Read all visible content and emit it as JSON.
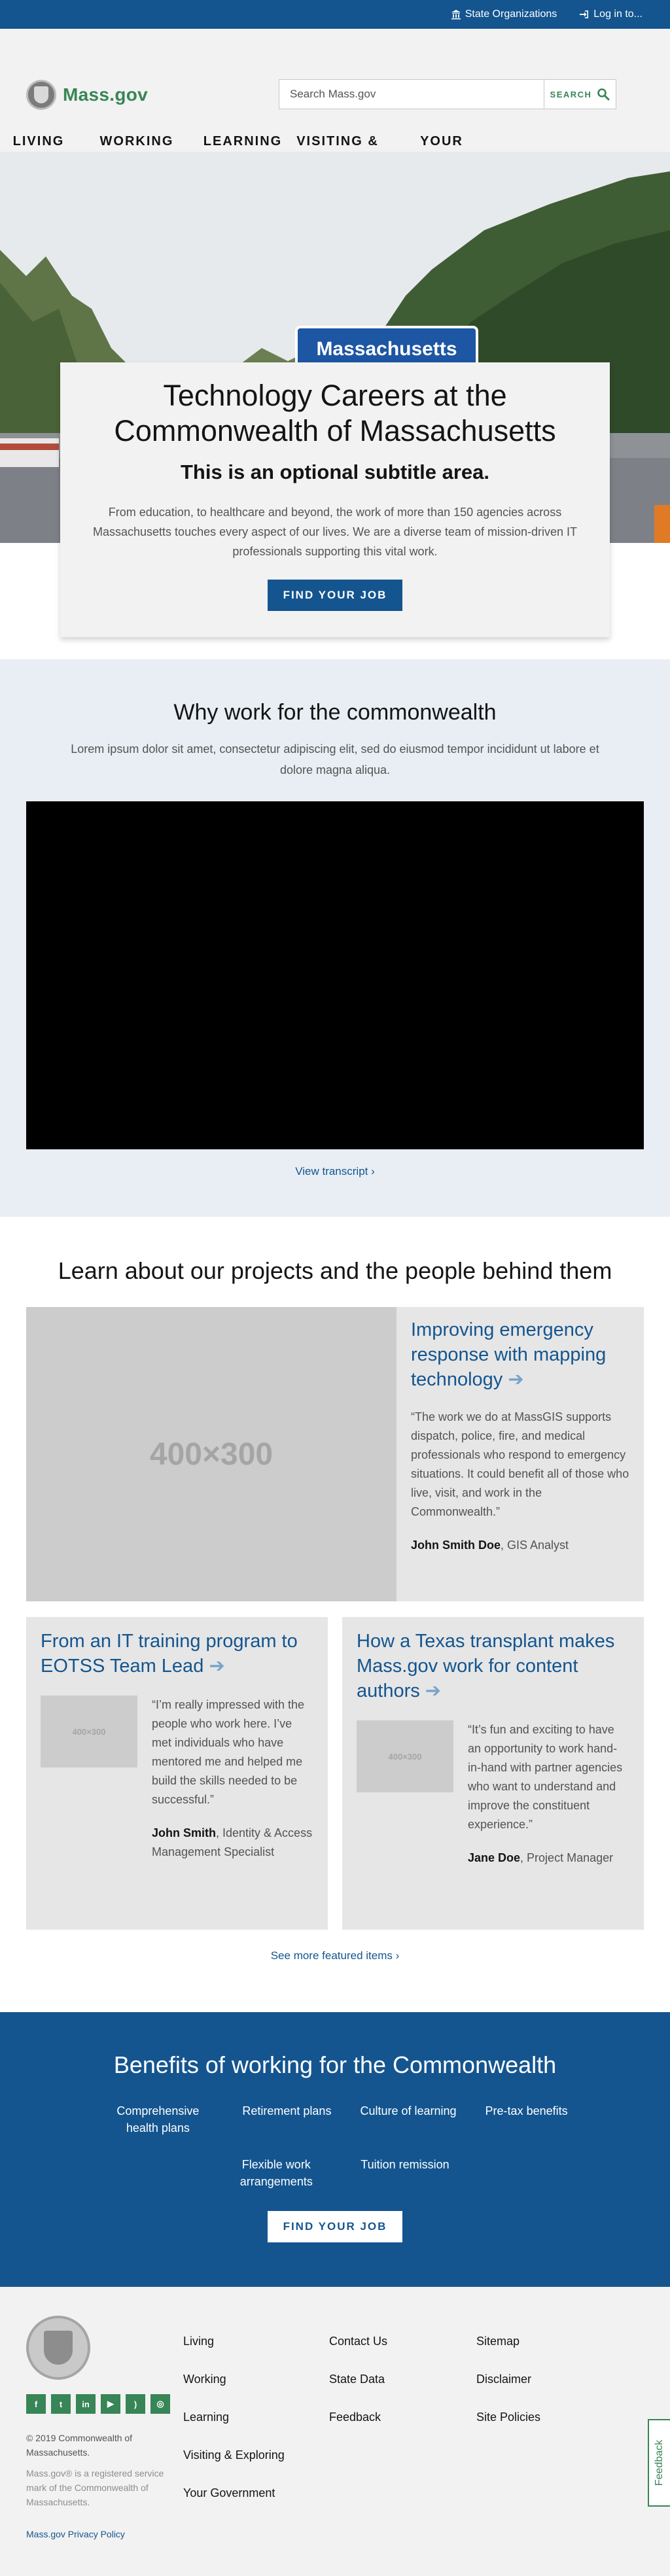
{
  "utility": {
    "state_orgs": "State Organizations",
    "login": "Log in to..."
  },
  "header": {
    "logo": "Mass.gov",
    "search_placeholder": "Search Mass.gov",
    "search_button": "SEARCH",
    "nav": [
      {
        "label": "LIVING"
      },
      {
        "label": "WORKING"
      },
      {
        "label": "LEARNING"
      },
      {
        "label": "VISITING & EXPLORING"
      },
      {
        "label": "YOUR GOVERNMENT"
      }
    ]
  },
  "hero": {
    "sign_text": "Massachusetts",
    "title": "Technology Careers at the Commonwealth of Massachusetts",
    "subtitle": "This is an optional subtitle area.",
    "description": "From education, to healthcare and beyond, the work of more than 150 agencies across Massachusetts touches every aspect of our lives. We are a diverse team of mission-driven IT professionals supporting this vital work.",
    "button": "FIND YOUR JOB"
  },
  "why": {
    "title": "Why work for the commonwealth",
    "text": "Lorem ipsum dolor sit amet, consectetur adipiscing elit, sed do eiusmod tempor incididunt ut labore et dolore magna aliqua.",
    "transcript_link": "View transcript"
  },
  "projects": {
    "title": "Learn about our projects and the people behind them",
    "feature": {
      "image": "400×300",
      "title": "Improving emergency response with mapping technology",
      "quote": "“The work we do at MassGIS supports dispatch, police, fire, and medical professionals who respond to emergency situations. It could benefit all of those who live, visit, and work in the Commonwealth.”",
      "name": "John Smith Doe",
      "role": ", GIS Analyst"
    },
    "cards": [
      {
        "image": "400×300",
        "title": "From an IT training program to EOTSS Team Lead",
        "quote": "“I’m really impressed with the people who work here. I’ve met individuals who have mentored me and helped me build the skills needed to be successful.”",
        "name": "John Smith",
        "role": ", Identity & Access Management Specialist"
      },
      {
        "image": "400×300",
        "title": "How a Texas transplant makes Mass.gov work for content authors",
        "quote": "“It’s fun and exciting to have an opportunity to work hand-in-hand with partner agencies who want to understand and improve the constituent experience.”",
        "name": "Jane Doe",
        "role": ", Project Manager"
      }
    ],
    "see_more": "See more featured items"
  },
  "benefits": {
    "title": "Benefits of working for the Commonwealth",
    "items_row1": [
      {
        "label": "Comprehensive health plans"
      },
      {
        "label": "Retirement plans"
      },
      {
        "label": "Culture of learning"
      },
      {
        "label": "Pre-tax benefits"
      }
    ],
    "items_row2": [
      {
        "label": "Flexible work arrangements"
      },
      {
        "label": "Tuition remission"
      }
    ],
    "button": "FIND YOUR JOB"
  },
  "footer": {
    "copyright": "© 2019 Commonwealth of Massachusetts.",
    "trademark": "Mass.gov® is a registered service mark of the Commonwealth of Massachusetts.",
    "privacy": "Mass.gov Privacy Policy",
    "col1": [
      "Living",
      "Working",
      "Learning",
      "Visiting & Exploring",
      "Your Government"
    ],
    "col2": [
      "Contact Us",
      "State Data",
      "Feedback"
    ],
    "col3": [
      "Sitemap",
      "Disclaimer",
      "Site Policies"
    ],
    "feedback_tab": "Feedback"
  }
}
